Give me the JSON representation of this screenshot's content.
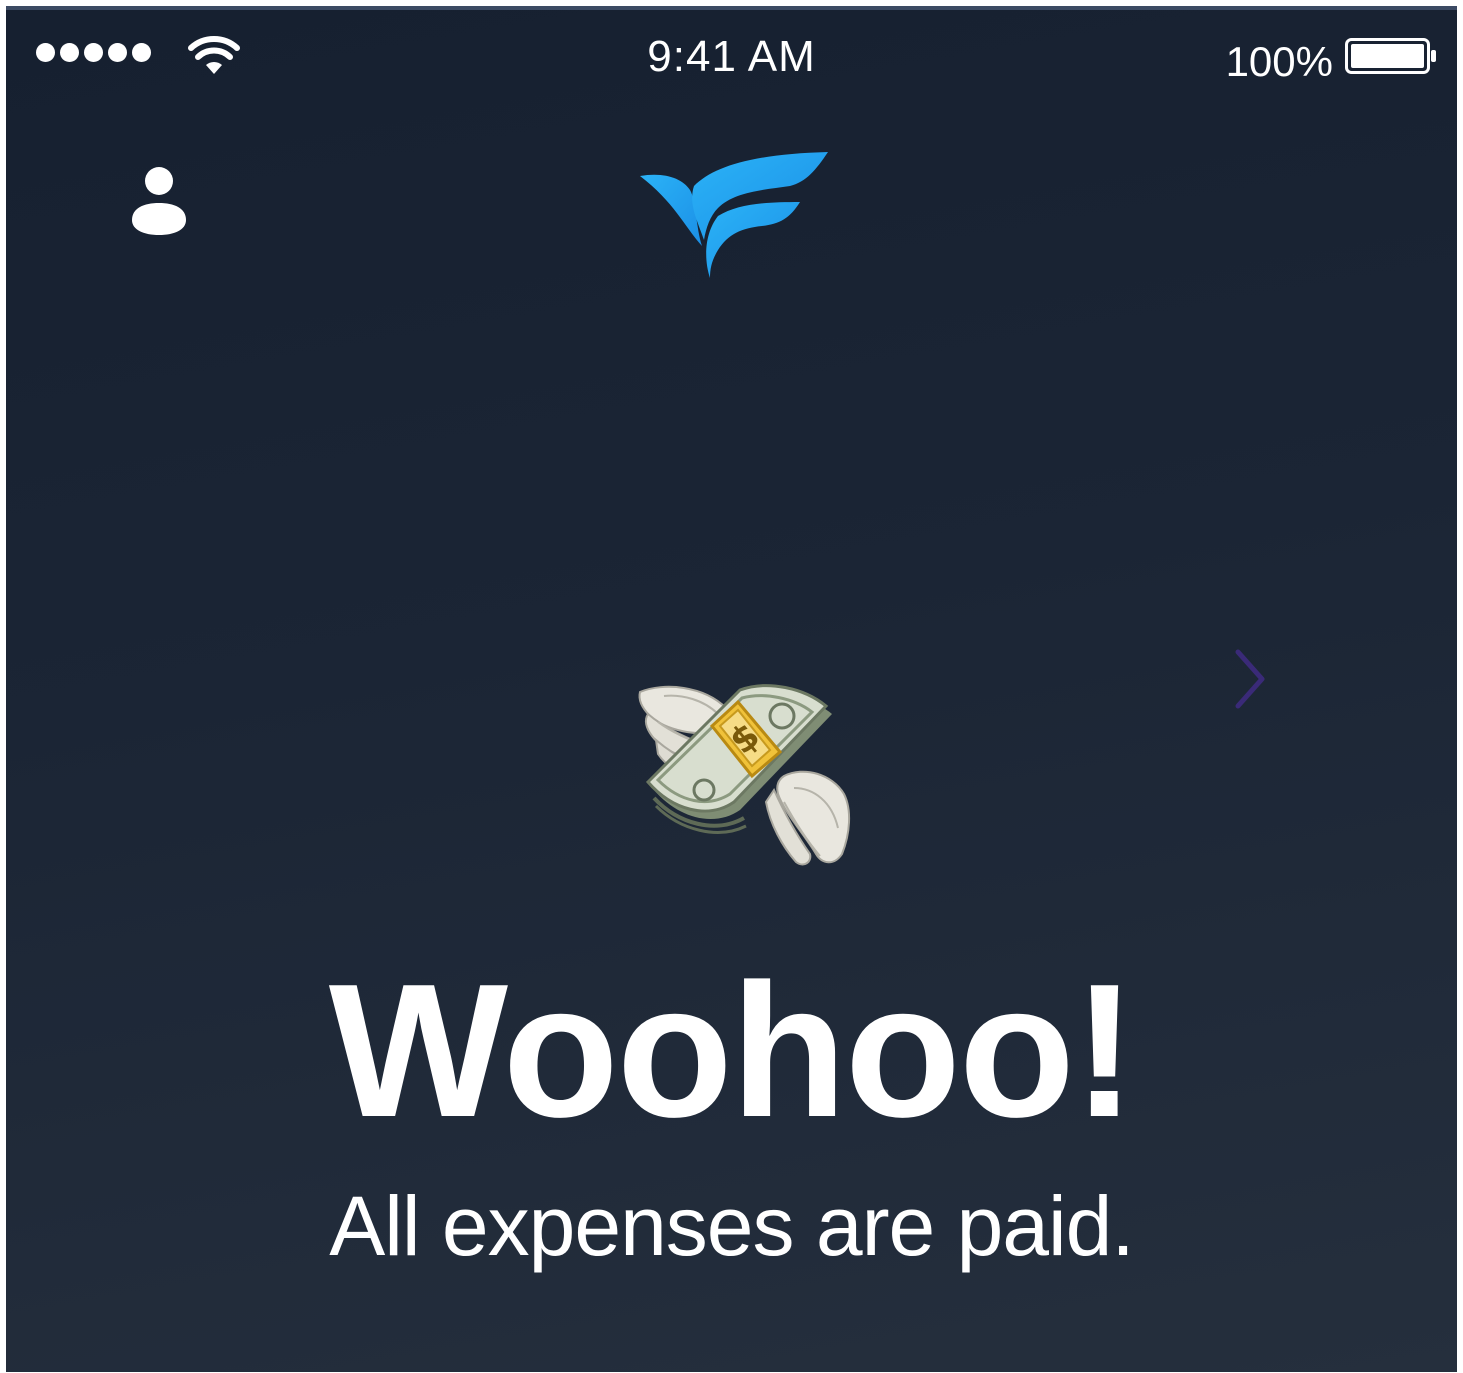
{
  "status_bar": {
    "time": "9:41 AM",
    "battery_percent": "100%",
    "battery_level": 1.0,
    "signal_bars": 5
  },
  "header": {
    "profile_icon": "person-icon",
    "logo_icon": "bird-wing-logo-icon"
  },
  "pager": {
    "next_icon": "chevron-right-icon"
  },
  "hero": {
    "illustration_icon": "money-with-wings-icon",
    "headline": "Woohoo!",
    "subline": "All expenses are paid."
  },
  "colors": {
    "background_top": "#162030",
    "background_bottom": "#252f3d",
    "logo_blue": "#1da1f2",
    "logo_blue_light": "#2bb3f7",
    "chevron": "#3a2a78",
    "text": "#ffffff"
  }
}
